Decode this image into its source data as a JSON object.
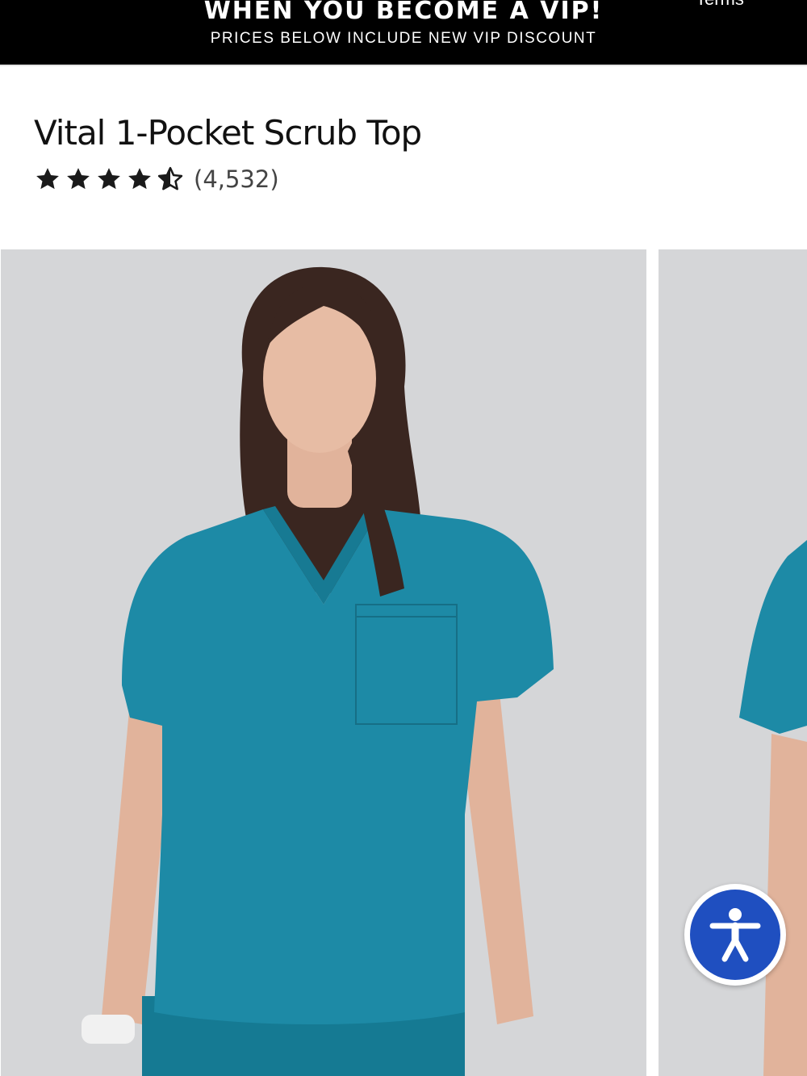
{
  "promo": {
    "headline": "WHEN YOU BECOME A VIP!",
    "subtext": "PRICES BELOW INCLUDE NEW VIP DISCOUNT",
    "terms_label": "Terms"
  },
  "product": {
    "title": "Vital 1-Pocket Scrub Top",
    "rating": 4.5,
    "rating_max": 5,
    "review_count": "(4,532)",
    "scrub_color": "#1d8aa6"
  },
  "gallery": {
    "images": [
      {
        "subject": "model wearing teal scrub top, front view"
      },
      {
        "subject": "model wearing teal scrub top, partial view"
      }
    ]
  },
  "accessibility": {
    "icon": "accessibility-person-icon",
    "color": "#1f4fc0"
  }
}
